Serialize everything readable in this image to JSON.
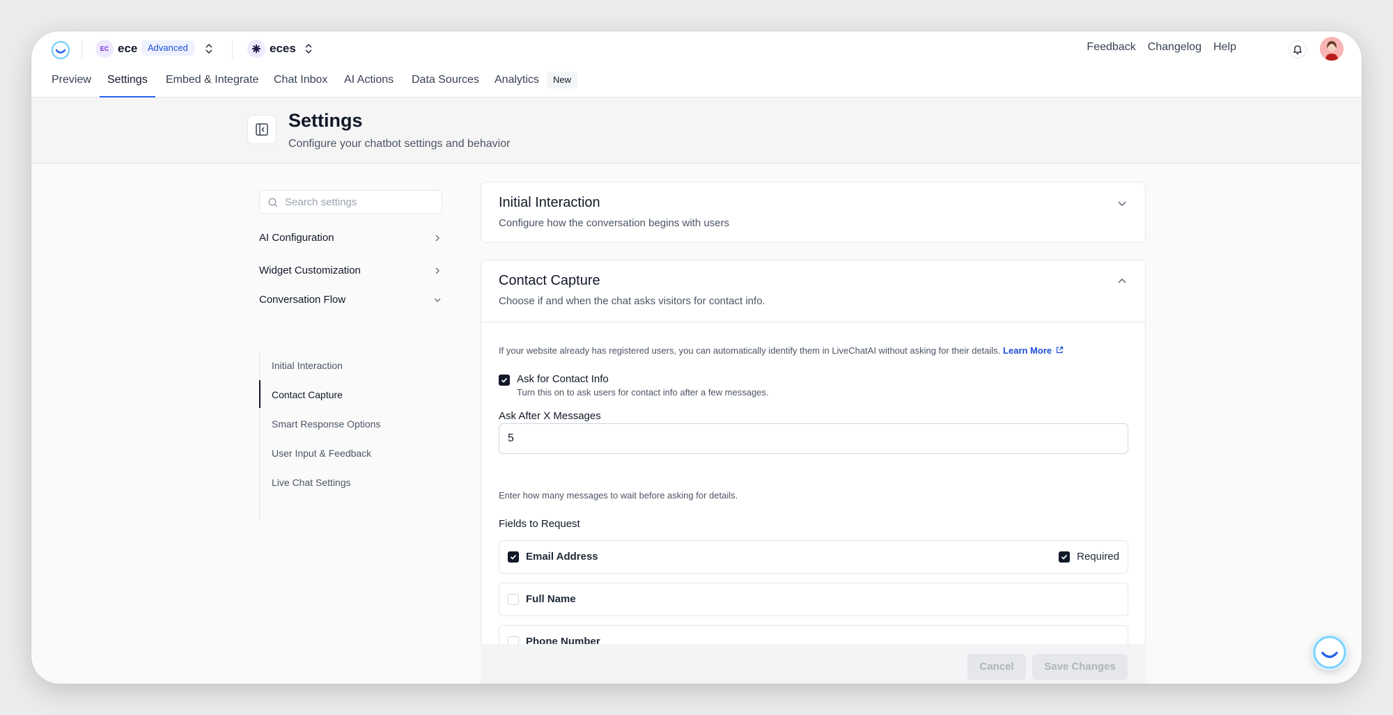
{
  "topbar": {
    "workspace_initials": "EC",
    "workspace_name": "ece",
    "plan_badge": "Advanced",
    "bot_name": "eces",
    "links": [
      "Feedback",
      "Changelog",
      "Help"
    ]
  },
  "tabs": [
    "Preview",
    "Settings",
    "Embed & Integrate",
    "Chat Inbox",
    "AI Actions",
    "Data Sources",
    "Analytics"
  ],
  "active_tab": "Settings",
  "analytics_badge": "New",
  "header": {
    "title": "Settings",
    "subtitle": "Configure your chatbot settings and behavior"
  },
  "sidebar": {
    "search_placeholder": "Search settings",
    "groups": [
      "AI Configuration",
      "Widget Customization",
      "Conversation Flow"
    ],
    "sub_items": [
      "Initial Interaction",
      "Contact Capture",
      "Smart Response Options",
      "User Input & Feedback",
      "Live Chat Settings"
    ],
    "active_sub_item": "Contact Capture"
  },
  "initial_interaction": {
    "title": "Initial Interaction",
    "description": "Configure how the conversation begins with users"
  },
  "contact_capture": {
    "title": "Contact Capture",
    "description": "Choose if and when the chat asks visitors for contact info.",
    "info_text": "If your website already has registered users, you can automatically identify them in LiveChatAI without asking for their details.",
    "learn_more": "Learn More",
    "ask_label": "Ask for Contact Info",
    "ask_help": "Turn this on to ask users for contact info after a few messages.",
    "ask_checked": true,
    "ask_after_label": "Ask After X Messages",
    "ask_after_value": "5",
    "ask_after_help": "Enter how many messages to wait before asking for details.",
    "fields_label": "Fields to Request",
    "fields": [
      {
        "name": "Email Address",
        "checked": true,
        "required_label": "Required",
        "required": true
      },
      {
        "name": "Full Name",
        "checked": false
      },
      {
        "name": "Phone Number",
        "checked": false
      }
    ]
  },
  "footer": {
    "cancel_label": "Cancel",
    "save_label": "Save Changes"
  },
  "colors": {
    "accent": "#2563eb",
    "checkbox_on": "#111827",
    "learn_more": "#1d4ed8"
  }
}
